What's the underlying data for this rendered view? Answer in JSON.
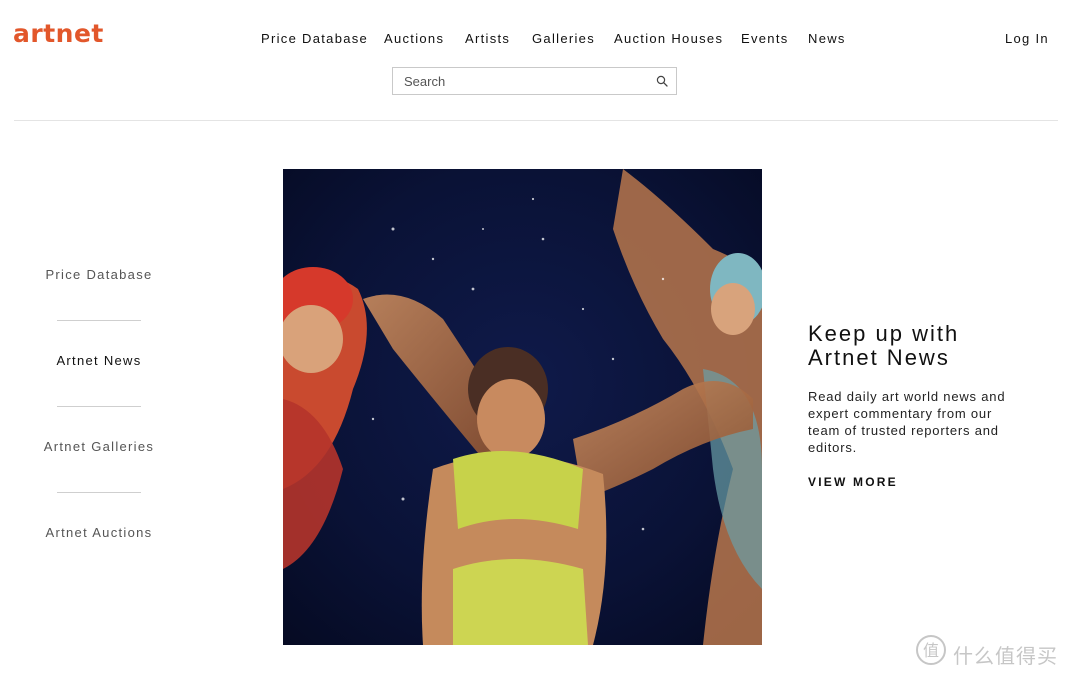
{
  "brand": {
    "logo": "artnet",
    "accent": "#e2572b"
  },
  "nav": {
    "items": [
      "Price Database",
      "Auctions",
      "Artists",
      "Galleries",
      "Auction Houses",
      "Events",
      "News"
    ],
    "login": "Log In"
  },
  "search": {
    "placeholder": "Search",
    "value": ""
  },
  "sidebar": {
    "items": [
      {
        "label": "Price Database",
        "active": false
      },
      {
        "label": "Artnet News",
        "active": true
      },
      {
        "label": "Artnet Galleries",
        "active": false
      },
      {
        "label": "Artnet Auctions",
        "active": false
      }
    ]
  },
  "promo": {
    "title_line1": "Keep up with",
    "title_line2": "Artnet News",
    "body_line1": "Read daily art world news and",
    "body_line2": "expert commentary from our",
    "body_line3": "team of trusted reporters and",
    "body_line4": "editors.",
    "link": "VIEW MORE"
  },
  "watermark": {
    "text": "什么值得买",
    "icon": "smzdm-logo-icon"
  }
}
